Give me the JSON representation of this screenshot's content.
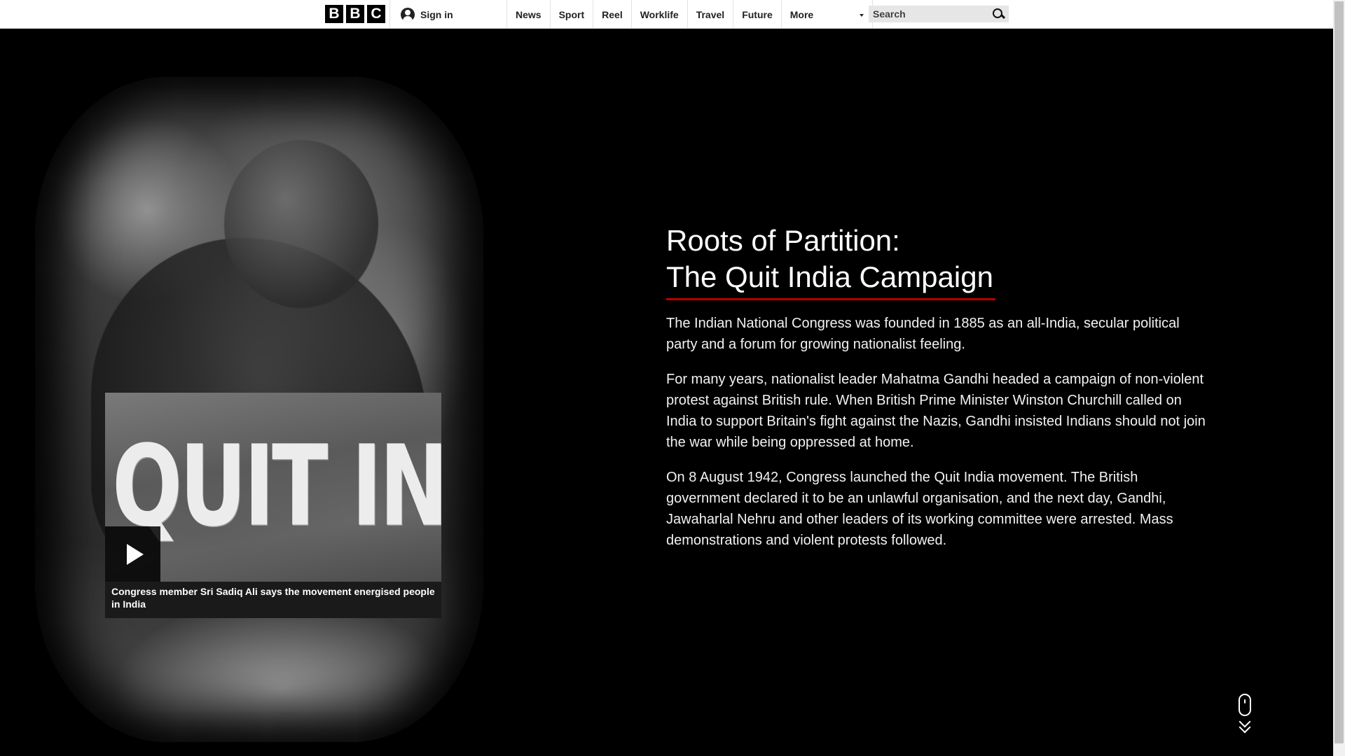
{
  "brand": {
    "logo_letters": [
      "B",
      "B",
      "C"
    ]
  },
  "header": {
    "signin_label": "Sign in",
    "nav": [
      "News",
      "Sport",
      "Reel",
      "Worklife",
      "Travel",
      "Future"
    ],
    "more_label": "More",
    "search_placeholder": "Search"
  },
  "video": {
    "thumb_text": "QUIT INDIA",
    "caption": "Congress member Sri Sadiq Ali says the movement energised people in India"
  },
  "article": {
    "title_line1": "Roots of Partition:",
    "title_line2": "The Quit India Campaign",
    "paragraphs": [
      "The Indian National Congress was founded in 1885 as an all-India, secular political party and a forum for growing nationalist feeling.",
      "For many years, nationalist leader Mahatma Gandhi headed a campaign of non-violent protest against British rule. When British Prime Minister Winston Churchill called on India to support Britain's fight against the Nazis, Gandhi insisted Indians should not join the war while being oppressed at home.",
      "On 8 August 1942, Congress launched the Quit India movement. The British government declared it to be an unlawful organisation, and the next day, Gandhi, Jawaharlal Nehru and other leaders of its working committee were arrested. Mass demonstrations and violent protests followed."
    ]
  },
  "colors": {
    "accent_red": "#b80000",
    "background": "#000000",
    "topbar": "#ffffff"
  },
  "icons": [
    "user-icon",
    "chevron-down-icon",
    "search-icon",
    "play-icon",
    "mouse-icon",
    "scroll-down-icon"
  ]
}
